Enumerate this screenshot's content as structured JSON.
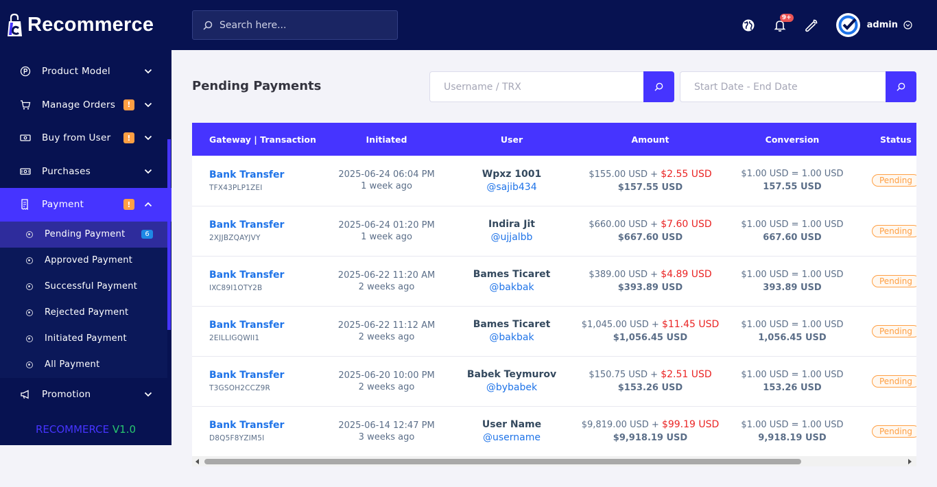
{
  "brand": {
    "name": "Recommerce"
  },
  "sidebar": {
    "items": [
      {
        "label": "Product Model",
        "icon": "circle-p-icon",
        "warn": ""
      },
      {
        "label": "Manage Orders",
        "icon": "cart-icon",
        "warn": "!"
      },
      {
        "label": "Buy from User",
        "icon": "cash-icon",
        "warn": "!"
      },
      {
        "label": "Purchases",
        "icon": "money-icon",
        "warn": ""
      },
      {
        "label": "Payment",
        "icon": "receipt-icon",
        "warn": "!"
      }
    ],
    "payment_sub": [
      {
        "label": "Pending Payment",
        "count": "6"
      },
      {
        "label": "Approved Payment"
      },
      {
        "label": "Successful Payment"
      },
      {
        "label": "Rejected Payment"
      },
      {
        "label": "Initiated Payment"
      },
      {
        "label": "All Payment"
      }
    ],
    "promotion": {
      "label": "Promotion",
      "icon": "megaphone-icon"
    },
    "version_name": "RECOMMERCE",
    "version_num": "V1.0"
  },
  "topbar": {
    "search_placeholder": "Search here...",
    "notify_count": "9+",
    "username": "admin"
  },
  "page": {
    "title": "Pending Payments",
    "filter_user_placeholder": "Username / TRX",
    "filter_date_placeholder": "Start Date - End Date"
  },
  "table": {
    "headers": [
      "Gateway | Transaction",
      "Initiated",
      "User",
      "Amount",
      "Conversion",
      "Status"
    ],
    "rows": [
      {
        "gateway": "Bank Transfer",
        "trx": "TFX43PLP1ZEI",
        "date": "2025-06-24 06:04 PM",
        "ago": "1 week ago",
        "name": "Wpxz 1001",
        "handle": "@sajib434",
        "amount": "$155.00 USD + ",
        "charge": "$2.55 USD",
        "total": "$157.55 USD",
        "rate": "$1.00 USD = 1.00 USD",
        "converted": "157.55 USD",
        "status": "Pending"
      },
      {
        "gateway": "Bank Transfer",
        "trx": "2XJJBZQAYJVY",
        "date": "2025-06-24 01:20 PM",
        "ago": "1 week ago",
        "name": "Indira Jit",
        "handle": "@ujjalbb",
        "amount": "$660.00 USD + ",
        "charge": "$7.60 USD",
        "total": "$667.60 USD",
        "rate": "$1.00 USD = 1.00 USD",
        "converted": "667.60 USD",
        "status": "Pending"
      },
      {
        "gateway": "Bank Transfer",
        "trx": "IXC89I1OTY2B",
        "date": "2025-06-22 11:20 AM",
        "ago": "2 weeks ago",
        "name": "Bames Ticaret",
        "handle": "@bakbak",
        "amount": "$389.00 USD + ",
        "charge": "$4.89 USD",
        "total": "$393.89 USD",
        "rate": "$1.00 USD = 1.00 USD",
        "converted": "393.89 USD",
        "status": "Pending"
      },
      {
        "gateway": "Bank Transfer",
        "trx": "2EILLIGQWII1",
        "date": "2025-06-22 11:12 AM",
        "ago": "2 weeks ago",
        "name": "Bames Ticaret",
        "handle": "@bakbak",
        "amount": "$1,045.00 USD + ",
        "charge": "$11.45 USD",
        "total": "$1,056.45 USD",
        "rate": "$1.00 USD = 1.00 USD",
        "converted": "1,056.45 USD",
        "status": "Pending"
      },
      {
        "gateway": "Bank Transfer",
        "trx": "T3GSOH2CCZ9R",
        "date": "2025-06-20 10:00 PM",
        "ago": "2 weeks ago",
        "name": "Babek Teymurov",
        "handle": "@bybabek",
        "amount": "$150.75 USD + ",
        "charge": "$2.51 USD",
        "total": "$153.26 USD",
        "rate": "$1.00 USD = 1.00 USD",
        "converted": "153.26 USD",
        "status": "Pending"
      },
      {
        "gateway": "Bank Transfer",
        "trx": "D8Q5F8YZIM5I",
        "date": "2025-06-14 12:47 PM",
        "ago": "3 weeks ago",
        "name": "User Name",
        "handle": "@username",
        "amount": "$9,819.00 USD + ",
        "charge": "$99.19 USD",
        "total": "$9,918.19 USD",
        "rate": "$1.00 USD = 1.00 USD",
        "converted": "9,918.19 USD",
        "status": "Pending"
      }
    ]
  },
  "colors": {
    "sidebar_bg": "#071251",
    "accent": "#4634ff",
    "link": "#1e73e8",
    "charge": "#ea2424",
    "pending": "#ff9f43"
  }
}
